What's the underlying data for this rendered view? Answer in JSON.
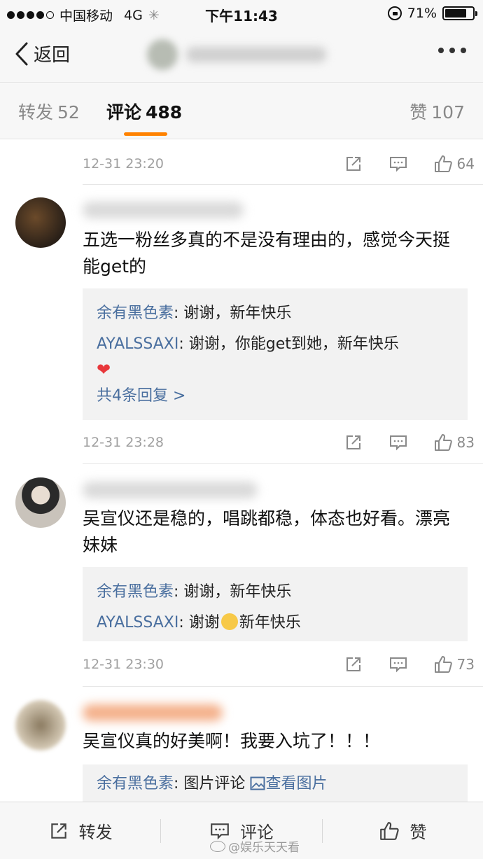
{
  "status_bar": {
    "carrier": "中国移动",
    "network": "4G",
    "time": "下午11:43",
    "battery": "71%",
    "battery_level": 0.71
  },
  "nav": {
    "back_label": "返回"
  },
  "tabs": {
    "repost_label": "转发",
    "repost_count": "52",
    "comment_label": "评论",
    "comment_count": "488",
    "likes_label": "赞",
    "likes_count": "107"
  },
  "comments": [
    {
      "time": "12-31 23:20",
      "likes": "64"
    },
    {
      "text": "五选一粉丝多真的不是没有理由的，感觉今天挺能get的",
      "replies": [
        {
          "who": "余有黑色素",
          "text": "谢谢，新年快乐"
        },
        {
          "who": "AYALSSAXI",
          "text": "谢谢，你能get到她，新年快乐"
        }
      ],
      "more_replies": "共4条回复 >",
      "time": "12-31 23:28",
      "likes": "83"
    },
    {
      "text": "吴宣仪还是稳的，唱跳都稳，体态也好看。漂亮妹妹",
      "replies": [
        {
          "who": "余有黑色素",
          "text": "谢谢，新年快乐"
        },
        {
          "who": "AYALSSAXI",
          "text_before": "谢谢",
          "text_after": "新年快乐"
        }
      ],
      "time": "12-31 23:30",
      "likes": "73"
    },
    {
      "text": "吴宣仪真的好美啊！我要入坑了！！！",
      "replies": [
        {
          "who": "余有黑色素",
          "text": "图片评论",
          "link": "查看图片"
        }
      ]
    }
  ],
  "bottom_bar": {
    "repost": "转发",
    "comment": "评论",
    "like": "赞"
  },
  "watermark": "@娱乐天天看"
}
